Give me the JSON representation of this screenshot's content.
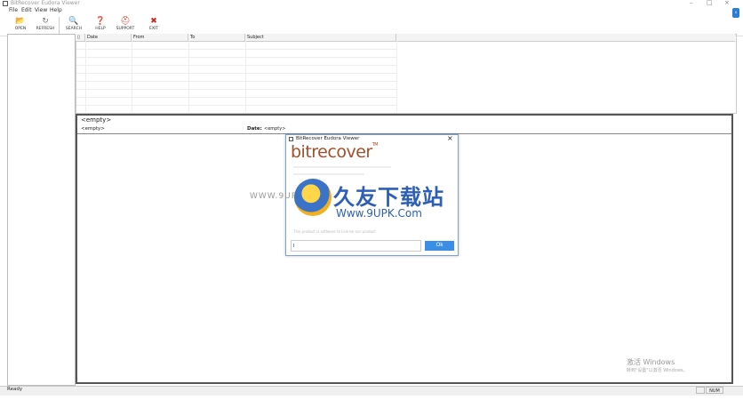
{
  "window": {
    "title": "BitRecover Eudora Viewer",
    "minimize": "–",
    "maximize": "□",
    "close": "×"
  },
  "menu": [
    "File",
    "Edit",
    "View",
    "Help"
  ],
  "toolbar": [
    {
      "label": "OPEN",
      "icon": "folder-icon",
      "glyph": "📂",
      "color": "#d9a23a"
    },
    {
      "label": "REFRESH",
      "icon": "refresh-icon",
      "glyph": "↻",
      "color": "#777777"
    },
    {
      "label": "SEARCH",
      "icon": "search-icon",
      "glyph": "🔍",
      "color": "#777777"
    },
    {
      "label": "HELP",
      "icon": "help-icon",
      "glyph": "❓",
      "color": "#3a73c8"
    },
    {
      "label": "SUPPORT",
      "icon": "support-icon",
      "glyph": "⛑",
      "color": "#d04030"
    },
    {
      "label": "EXIT",
      "icon": "exit-icon",
      "glyph": "✖",
      "color": "#d02020"
    }
  ],
  "mail_list": {
    "columns": [
      "",
      "Date",
      "From",
      "To",
      "Subject"
    ]
  },
  "preview": {
    "subject": "<empty>",
    "from": "<empty>",
    "date_label": "Date:",
    "date_value": "<empty>"
  },
  "dialog": {
    "title": "BitRecover Eudora Viewer",
    "close": "×",
    "brand": "bitrecover",
    "tm": "TM",
    "info_text": "This product is software to license our product",
    "input_value": "I",
    "ok_label": "Ok"
  },
  "watermark": {
    "url_left": "WWW.9UPK.COM",
    "cn_text": "久友下载站",
    "url": "Www.9UPK.Com"
  },
  "activate": {
    "line1": "激活 Windows",
    "line2": "转到\"设置\"以激活 Windows。"
  },
  "status": {
    "text": "Ready",
    "num": "NUM"
  },
  "colors": {
    "accent": "#3a8ee6",
    "brand": "#a34f2a"
  }
}
